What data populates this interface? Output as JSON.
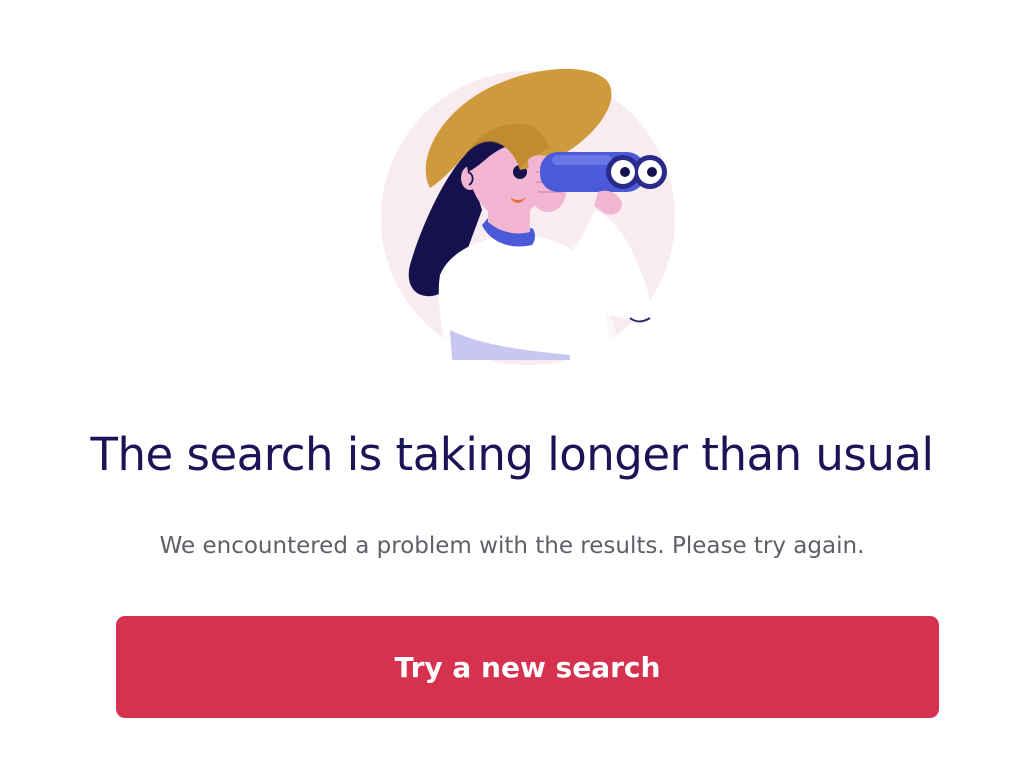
{
  "illustration": {
    "icon": "woman-with-binoculars-icon",
    "colors": {
      "backdrop": "#f8ecf1",
      "hat": "#cf9a3c",
      "hair": "#15114e",
      "skin": "#f2b6d3",
      "binoculars": "#4b5ad8",
      "shirt": "#ffffff",
      "collar": "#4b5ad8"
    }
  },
  "message": {
    "title": "The search is taking longer than usual",
    "subtitle": "We encountered a problem with the results. Please try again."
  },
  "actions": {
    "retry_label": "Try a new search"
  },
  "theme": {
    "title_color": "#1b1457",
    "subtitle_color": "#5f5f68",
    "button_color": "#d6314f",
    "button_text_color": "#ffffff"
  }
}
